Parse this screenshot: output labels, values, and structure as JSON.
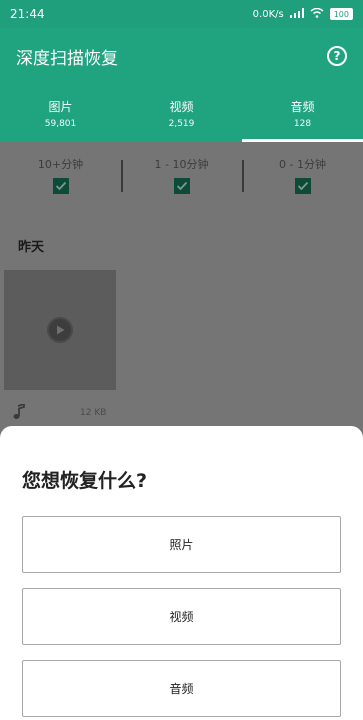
{
  "status_bar": {
    "time": "21:44",
    "network_speed": "0.0K/s",
    "battery": "100"
  },
  "app_bar": {
    "title": "深度扫描恢复",
    "help_icon": "question-circle-icon"
  },
  "tabs": [
    {
      "label": "图片",
      "count": "59,801",
      "active": false
    },
    {
      "label": "视频",
      "count": "2,519",
      "active": false
    },
    {
      "label": "音频",
      "count": "128",
      "active": true
    }
  ],
  "filters": [
    {
      "label": "10+分钟",
      "checked": true
    },
    {
      "label": "1 - 10分钟",
      "checked": true
    },
    {
      "label": "0 - 1分钟",
      "checked": true
    }
  ],
  "section": {
    "title": "昨天"
  },
  "item": {
    "size": "12 KB"
  },
  "sheet": {
    "title": "您想恢复什么?",
    "options": [
      "照片",
      "视频",
      "音频"
    ]
  },
  "colors": {
    "primary": "#20a37f",
    "checkbox": "#0d4a37",
    "overlay": "#757575"
  }
}
